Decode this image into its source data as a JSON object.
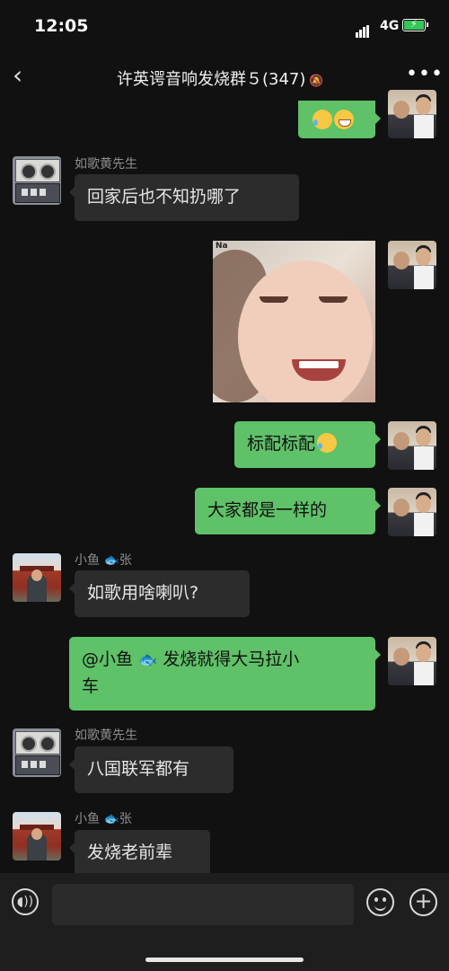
{
  "status_bar": {
    "time": "12:05",
    "network": "4G"
  },
  "header": {
    "title": "许英谔音响发烧群５(347)"
  },
  "messages": [
    {
      "side": "right",
      "emojis": [
        "tear-joy-emoji",
        "grin-emoji"
      ]
    },
    {
      "side": "left",
      "sender": "如歌黄先生",
      "text": "回家后也不知扔哪了"
    },
    {
      "side": "right",
      "sticker_tag": "Na"
    },
    {
      "side": "right",
      "text": "标配标配"
    },
    {
      "side": "right",
      "text": "大家都是一样的"
    },
    {
      "side": "left",
      "sender": "小鱼",
      "sender_suffix": "张",
      "text": "如歌用啥喇叭?"
    },
    {
      "side": "right",
      "text_line1": "@小鱼",
      "text_line1b": "发烧就得大马拉小",
      "text_line2": "车"
    },
    {
      "side": "left",
      "sender": "如歌黄先生",
      "text": "八国联军都有"
    },
    {
      "side": "left",
      "sender": "小鱼",
      "sender_suffix": "张",
      "text": "发烧老前辈"
    }
  ],
  "colors": {
    "background": "#111111",
    "bubble_right": "#5fc168",
    "bubble_left": "#2c2c2c"
  }
}
